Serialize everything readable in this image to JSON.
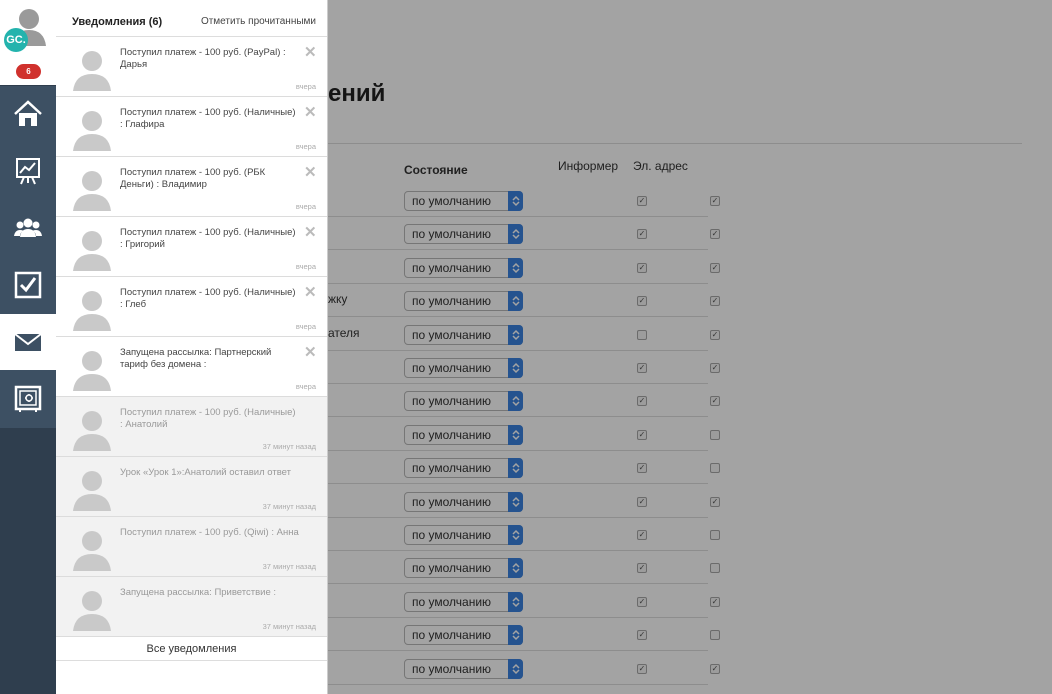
{
  "user": {
    "initials": "GC.",
    "notification_count": "6"
  },
  "sidebar": {
    "items": [
      {
        "icon": "home-icon",
        "active": false
      },
      {
        "icon": "chart-icon",
        "active": false
      },
      {
        "icon": "users-icon",
        "active": false
      },
      {
        "icon": "checkbox-icon",
        "active": false
      },
      {
        "icon": "mail-icon",
        "active": true
      },
      {
        "icon": "safe-icon",
        "active": false
      }
    ]
  },
  "notifications_panel": {
    "title": "Уведомления (6)",
    "mark_read_label": "Отметить прочитанными",
    "all_label": "Все уведомления",
    "items": [
      {
        "text": "Поступил платеж - 100 руб. (PayPal) : Дарья",
        "time": "вчера",
        "read": false
      },
      {
        "text": "Поступил платеж - 100 руб. (Наличные) : Глафира",
        "time": "вчера",
        "read": false
      },
      {
        "text": "Поступил платеж - 100 руб. (РБК Деньги) : Владимир",
        "time": "вчера",
        "read": false
      },
      {
        "text": "Поступил платеж - 100 руб. (Наличные) : Григорий",
        "time": "вчера",
        "read": false
      },
      {
        "text": "Поступил платеж - 100 руб. (Наличные) : Глеб",
        "time": "вчера",
        "read": false
      },
      {
        "text": "Запущена рассылка: Партнерский тариф без домена :",
        "time": "вчера",
        "read": false
      },
      {
        "text": "Поступил платеж - 100 руб. (Наличные) : Анатолий",
        "time": "37 минут назад",
        "read": true
      },
      {
        "text": "Урок «Урок 1»:Анатолий оставил ответ",
        "time": "37 минут назад",
        "read": true
      },
      {
        "text": "Поступил платеж - 100 руб. (Qiwi) : Анна",
        "time": "37 минут назад",
        "read": true
      },
      {
        "text": "Запущена рассылка: Приветствие :",
        "time": "37 минут назад",
        "read": true
      }
    ]
  },
  "page": {
    "title_visible": "ений",
    "columns": {
      "state": "Состояние",
      "informer": "Информер",
      "email": "Эл. адрес"
    },
    "rows": [
      {
        "label": "",
        "state": "по умолчанию",
        "informer": true,
        "email": true
      },
      {
        "label": "",
        "state": "по умолчанию",
        "informer": true,
        "email": true
      },
      {
        "label": "",
        "state": "по умолчанию",
        "informer": true,
        "email": true
      },
      {
        "label": "жку",
        "state": "по умолчанию",
        "informer": true,
        "email": true
      },
      {
        "label": "ателя",
        "state": "по умолчанию",
        "informer": false,
        "email": true
      },
      {
        "label": "",
        "state": "по умолчанию",
        "informer": true,
        "email": true
      },
      {
        "label": "",
        "state": "по умолчанию",
        "informer": true,
        "email": true
      },
      {
        "label": "",
        "state": "по умолчанию",
        "informer": true,
        "email": false
      },
      {
        "label": "",
        "state": "по умолчанию",
        "informer": true,
        "email": false
      },
      {
        "label": "",
        "state": "по умолчанию",
        "informer": true,
        "email": true
      },
      {
        "label": "",
        "state": "по умолчанию",
        "informer": true,
        "email": false
      },
      {
        "label": "",
        "state": "по умолчанию",
        "informer": true,
        "email": false
      },
      {
        "label": "",
        "state": "по умолчанию",
        "informer": true,
        "email": true
      },
      {
        "label": "",
        "state": "по умолчанию",
        "informer": true,
        "email": false
      },
      {
        "label": "",
        "state": "по умолчанию",
        "informer": true,
        "email": true
      }
    ]
  },
  "colors": {
    "sidebar": "#2f3e4e",
    "badge": "#d0312d",
    "avatar_initials_bg": "#23b3ad",
    "select_arrow": "#3b83e0"
  }
}
